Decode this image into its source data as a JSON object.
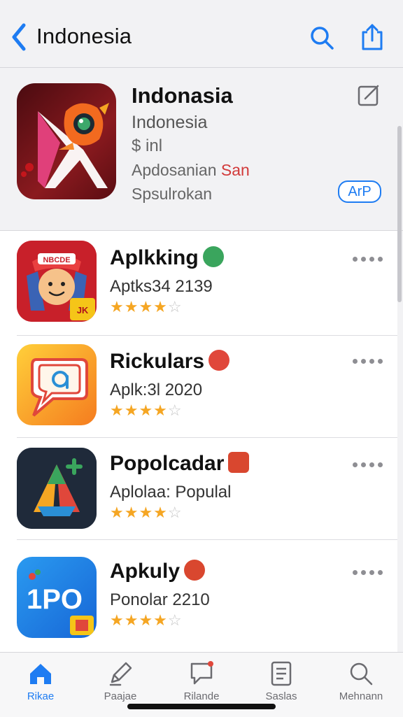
{
  "nav": {
    "title": "Indonesia"
  },
  "featured": {
    "name": "Indonasia",
    "line1": "Indonesia",
    "line2": "$ inl",
    "line3_prefix": "Apdosanian ",
    "line3_accent": "San",
    "line4": "Spsulrokan",
    "get_label": "ArP"
  },
  "apps": [
    {
      "name": "Aplkking",
      "subtitle": "Aptks34 2139",
      "rating": 4
    },
    {
      "name": "Rickulars",
      "subtitle": "Aplk:3l 2020",
      "rating": 4
    },
    {
      "name": "Popolcadar",
      "subtitle": "Aplolaa: Populal",
      "rating": 4
    },
    {
      "name": "Apkuly",
      "subtitle": "Ponolar 2210",
      "rating": 4
    }
  ],
  "app_icon_text": {
    "app4": "1PO"
  },
  "tabs": [
    {
      "label": "Rikae",
      "icon": "home-icon",
      "active": true
    },
    {
      "label": "Paajae",
      "icon": "pen-icon",
      "active": false
    },
    {
      "label": "Rilande",
      "icon": "chat-bubble-icon",
      "active": false
    },
    {
      "label": "Saslas",
      "icon": "document-icon",
      "active": false
    },
    {
      "label": "Mehnann",
      "icon": "search-icon",
      "active": false
    }
  ],
  "colors": {
    "accent": "#1e7cf2",
    "star": "#f5a623"
  }
}
